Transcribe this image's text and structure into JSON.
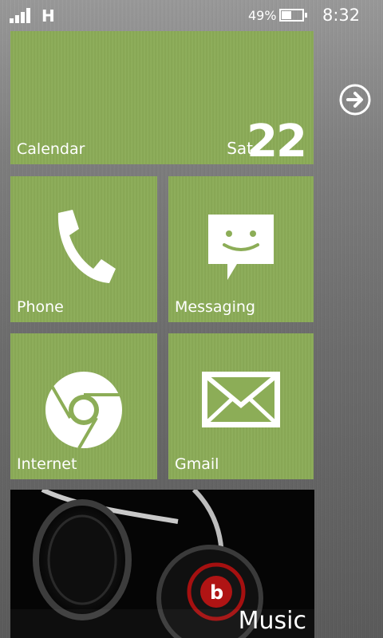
{
  "status_bar": {
    "network_type": "H",
    "battery_percent": "49%",
    "battery_level": 0.49,
    "time": "8:32"
  },
  "tiles": {
    "calendar": {
      "label": "Calendar",
      "day": "Sat",
      "date": "22"
    },
    "phone": {
      "label": "Phone",
      "icon": "phone-handset-icon"
    },
    "messaging": {
      "label": "Messaging",
      "icon": "smiley-speech-bubble-icon"
    },
    "internet": {
      "label": "Internet",
      "icon": "chrome-logo-icon"
    },
    "gmail": {
      "label": "Gmail",
      "icon": "envelope-icon"
    },
    "music": {
      "label": "Music",
      "image": "headphones-photo"
    }
  },
  "nav": {
    "icon": "arrow-right-circle-icon"
  },
  "colors": {
    "tile_green": "#8cad57",
    "music_bg": "#050505",
    "text": "#ffffff"
  }
}
